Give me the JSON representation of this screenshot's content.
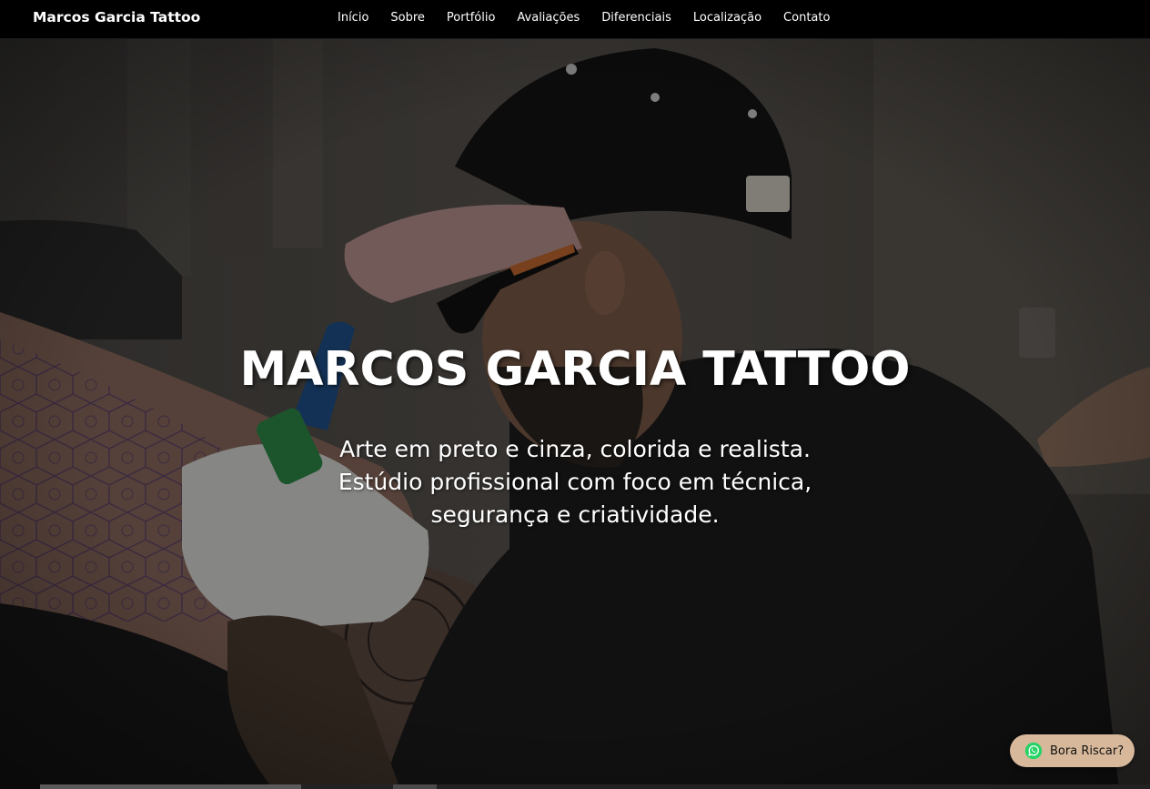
{
  "navbar": {
    "brand": "Marcos Garcia Tattoo",
    "links": [
      "Início",
      "Sobre",
      "Portfólio",
      "Avaliações",
      "Diferenciais",
      "Localização",
      "Contato"
    ]
  },
  "hero": {
    "title": "MARCOS GARCIA TATTOO",
    "subtitle": "Arte em preto e cinza, colorida e realista. Estúdio profissional com foco em técnica, segurança e criatividade.",
    "image_icon": "tattoo-artist-photo"
  },
  "whatsapp_button": {
    "label": "Bora Riscar?",
    "icon": "whatsapp-icon",
    "background": "#d8b89b"
  },
  "colors": {
    "navbar": "#000000",
    "accent": "#d8b89b",
    "text": "#ffffff"
  }
}
